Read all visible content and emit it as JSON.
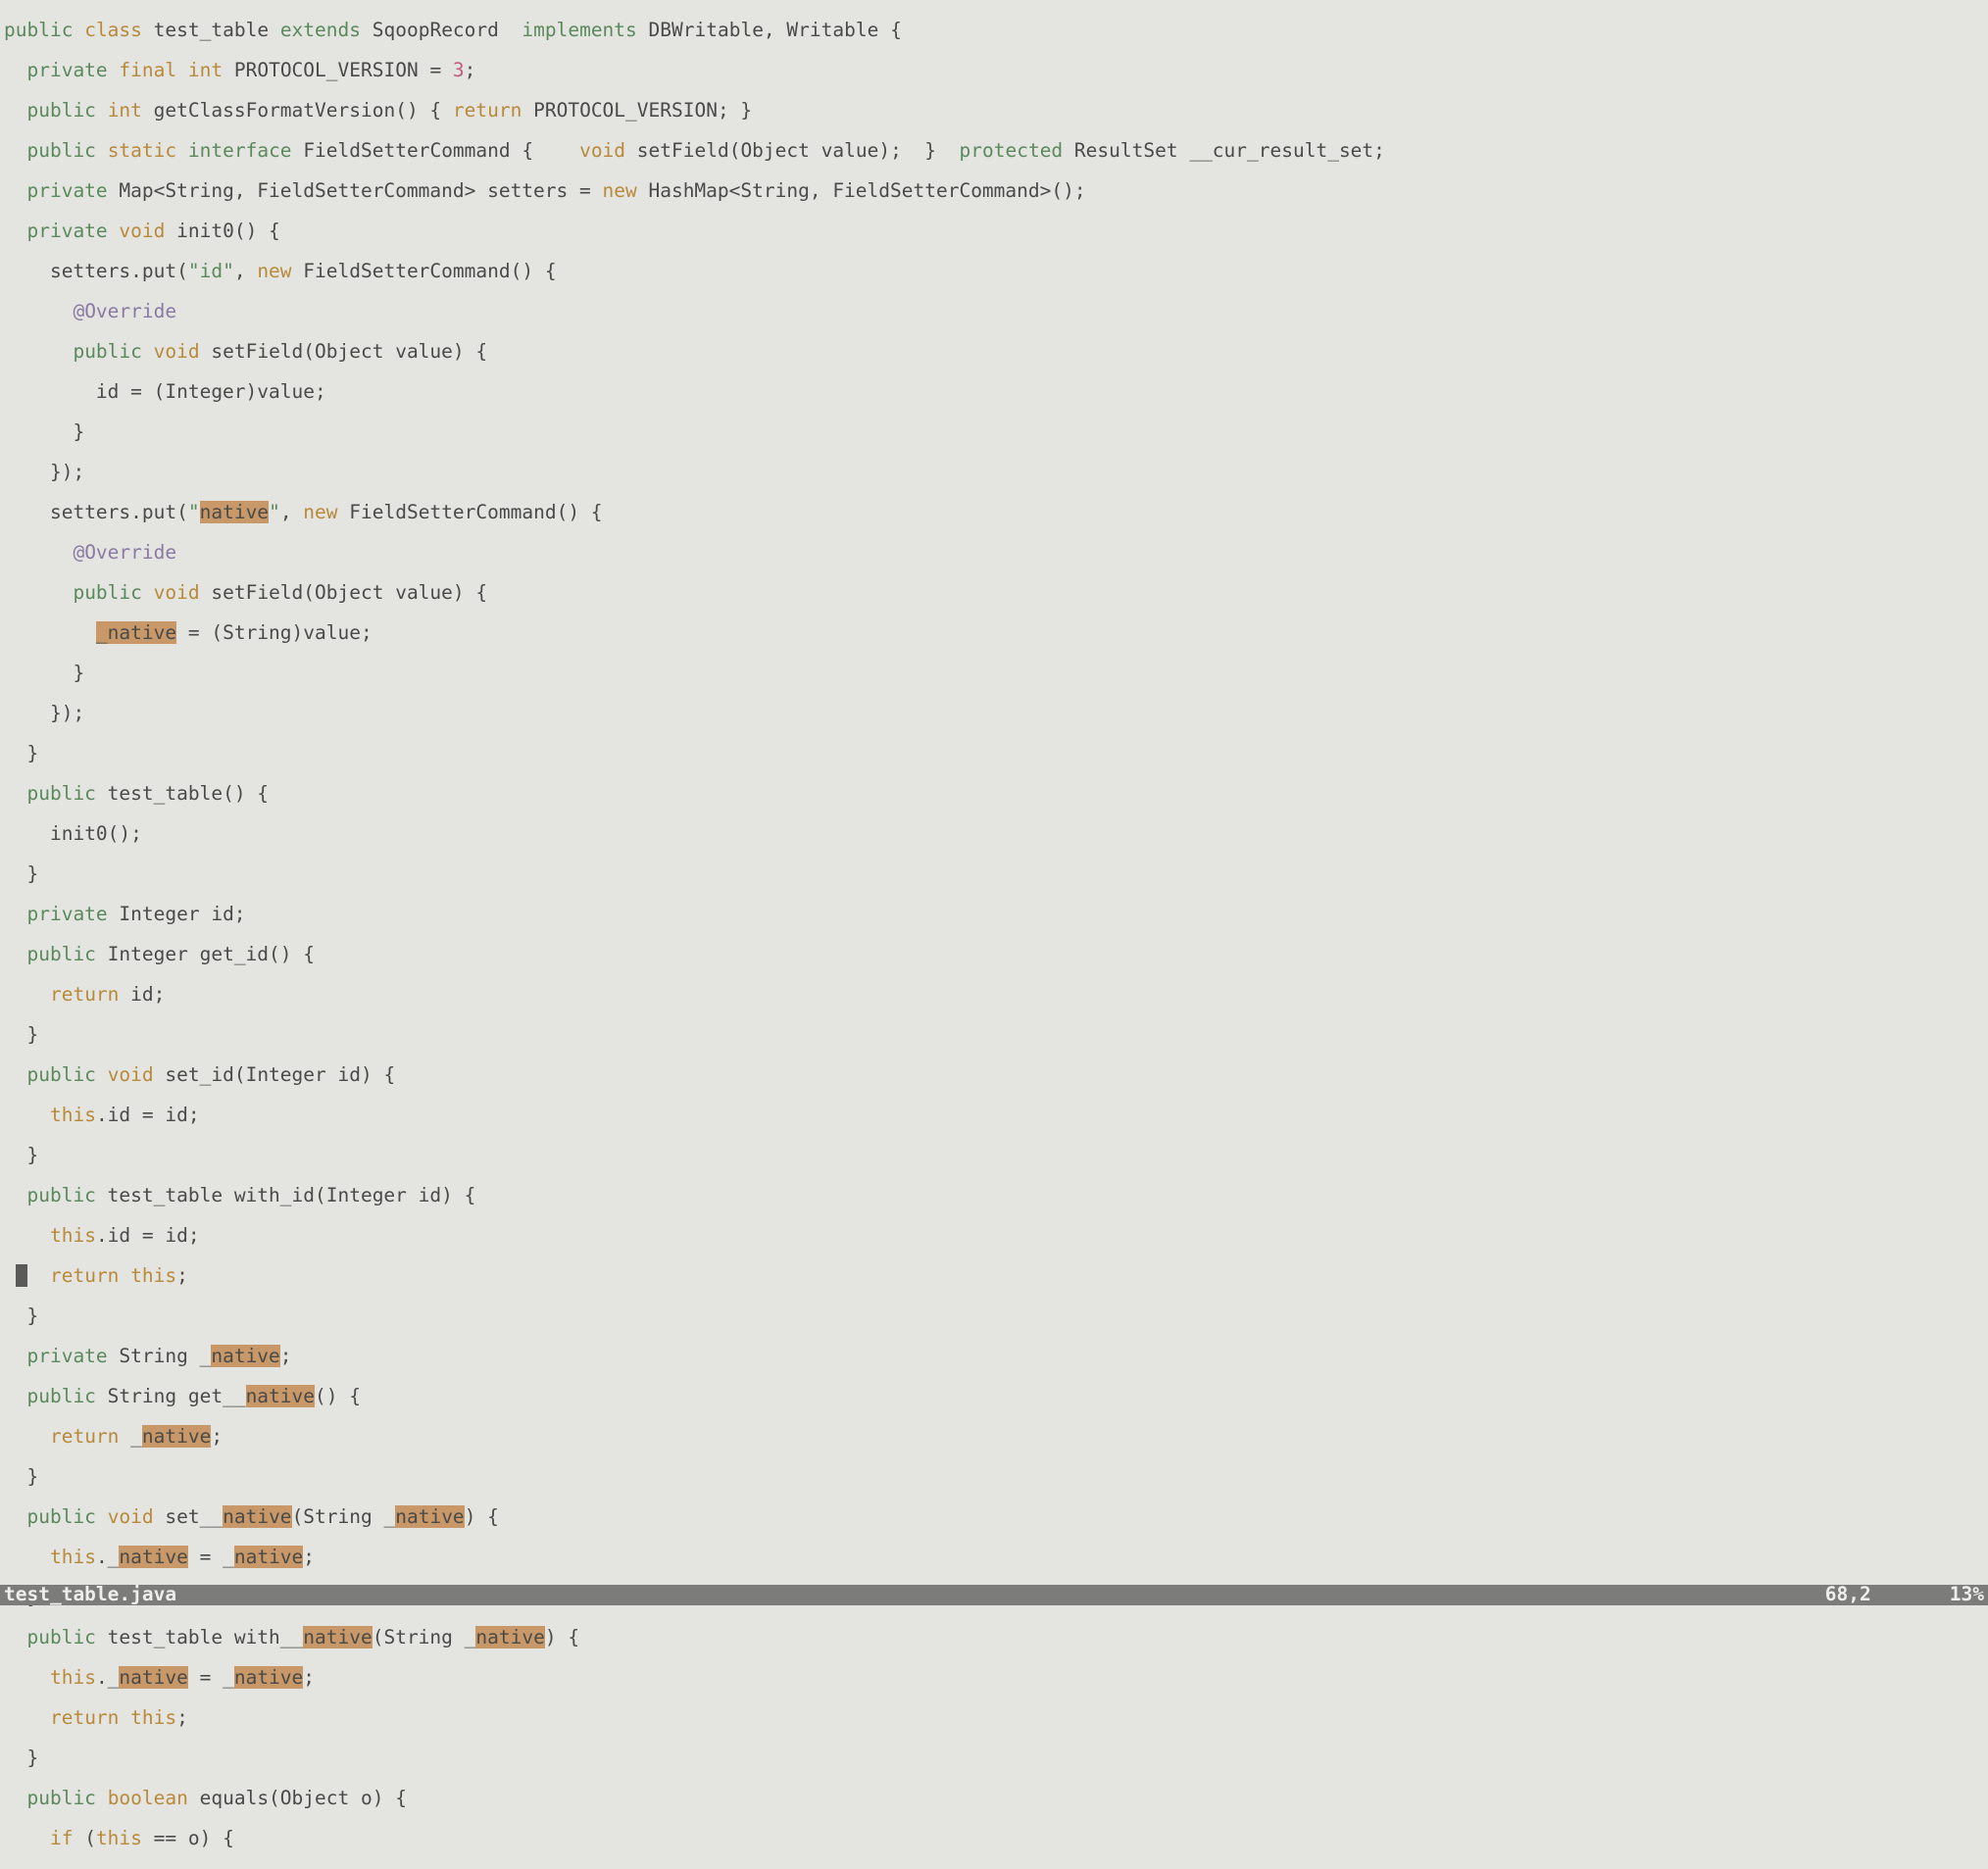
{
  "status": {
    "filename": "test_table.java",
    "position": "68,2",
    "percent": "13%"
  },
  "code": {
    "l1": {
      "public": "public",
      "class": "class",
      "name": "test_table",
      "extends": "extends",
      "base": "SqoopRecord",
      "implements": "implements",
      "ifaces": "DBWritable, Writable {"
    },
    "l2": {
      "private": "private",
      "final": "final",
      "int": "int",
      "rest": "PROTOCOL_VERSION = ",
      "num": "3",
      "end": ";"
    },
    "l3": {
      "public": "public",
      "int": "int",
      "m": "getClassFormatVersion() { ",
      "return": "return",
      "r": " PROTOCOL_VERSION; }"
    },
    "l4": {
      "public": "public",
      "static": "static",
      "interface": "interface",
      "n": "FieldSetterCommand {    ",
      "void": "void",
      "m": " setField(Object value);  }  ",
      "protected": "protected",
      "r": " ResultSet __cur_result_set;"
    },
    "l5": {
      "private": "private",
      "r1": " Map<String, FieldSetterCommand> setters = ",
      "new": "new",
      "r2": " HashMap<String, FieldSetterCommand>();"
    },
    "l6": {
      "private": "private",
      "void": "void",
      "r": " init0() {"
    },
    "l7": {
      "a": "setters.put(",
      "s": "\"id\"",
      "b": ", ",
      "new": "new",
      "c": " FieldSetterCommand() {"
    },
    "l8": {
      "anno": "@Override"
    },
    "l9": {
      "public": "public",
      "void": "void",
      "r": " setField(Object value) {"
    },
    "l10": {
      "r": "id = (Integer)value;"
    },
    "l11": {
      "r": "}"
    },
    "l12": {
      "r": "});"
    },
    "l13": {
      "a": "setters.put(",
      "q1": "\"",
      "s": "native",
      "q2": "\"",
      "b": ", ",
      "new": "new",
      "c": " FieldSetterCommand() {"
    },
    "l14": {
      "anno": "@Override"
    },
    "l15": {
      "public": "public",
      "void": "void",
      "r": " setField(Object value) {"
    },
    "l16": {
      "u": "_",
      "h": "native",
      "r": " = (String)value;"
    },
    "l17": {
      "r": "}"
    },
    "l18": {
      "r": "});"
    },
    "l19": {
      "r": "}"
    },
    "l20": {
      "public": "public",
      "r": " test_table() {"
    },
    "l21": {
      "r": "init0();"
    },
    "l22": {
      "r": "}"
    },
    "l23": {
      "private": "private",
      "r": " Integer id;"
    },
    "l24": {
      "public": "public",
      "r": " Integer get_id() {"
    },
    "l25": {
      "return": "return",
      "r": " id;"
    },
    "l26": {
      "r": "}"
    },
    "l27": {
      "public": "public",
      "void": "void",
      "r": " set_id(Integer id) {"
    },
    "l28": {
      "this": "this",
      "r": ".id = id;"
    },
    "l29": {
      "r": "}"
    },
    "l30": {
      "public": "public",
      "r": " test_table with_id(Integer id) {"
    },
    "l31": {
      "this": "this",
      "r": ".id = id;"
    },
    "l32": {
      "c": " ",
      "return": "return",
      "this": "this",
      "r": ";"
    },
    "l33": {
      "r": "}"
    },
    "l34": {
      "private": "private",
      "a": " String _",
      "h": "native",
      "b": ";"
    },
    "l35": {
      "public": "public",
      "a": " String get__",
      "h": "native",
      "b": "() {"
    },
    "l36": {
      "return": "return",
      "a": " _",
      "h": "native",
      "b": ";"
    },
    "l37": {
      "r": "}"
    },
    "l38": {
      "public": "public",
      "void": "void",
      "a": " set__",
      "h1": "native",
      "b": "(String _",
      "h2": "native",
      "c": ") {"
    },
    "l39": {
      "this": "this",
      "a": "._",
      "h1": "native",
      "b": " = _",
      "h2": "native",
      "c": ";"
    },
    "l40": {
      "r": "}"
    },
    "l41": {
      "public": "public",
      "a": " test_table with__",
      "h1": "native",
      "b": "(String _",
      "h2": "native",
      "c": ") {"
    },
    "l42": {
      "this": "this",
      "a": "._",
      "h1": "native",
      "b": " = _",
      "h2": "native",
      "c": ";"
    },
    "l43": {
      "return": "return",
      "this": "this",
      "r": ";"
    },
    "l44": {
      "r": "}"
    },
    "l45": {
      "public": "public",
      "boolean": "boolean",
      "r": " equals(Object o) {"
    },
    "l46": {
      "if": "if",
      "a": " (",
      "this": "this",
      "b": " == o) {"
    }
  }
}
